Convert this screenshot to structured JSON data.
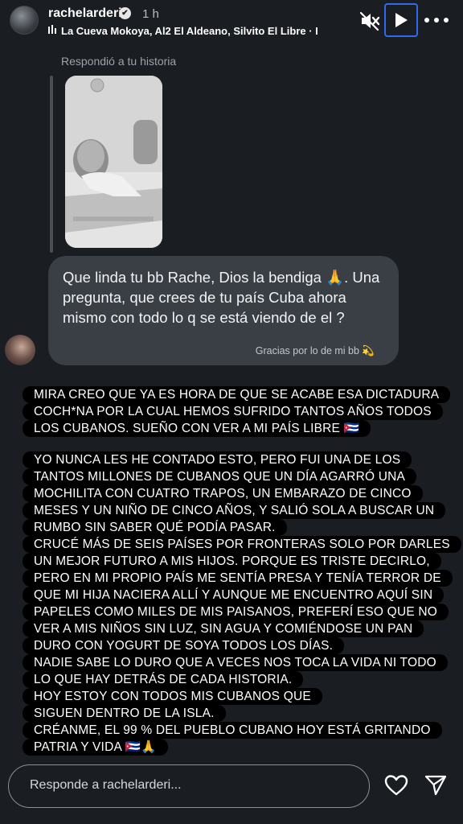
{
  "header": {
    "username": "rachelarderi",
    "verified_badge": "✔",
    "time": "1 h",
    "music_icon": "music-bars-icon",
    "music": "La Cueva Mokoya, Al2 El Aldeano, Silvito El Libre · I",
    "controls": [
      "mute-icon",
      "play-icon",
      "more-icon"
    ]
  },
  "story_reply": {
    "label": "Respondió a tu historia"
  },
  "received_message": {
    "text": "Que linda tu bb Rache, Dios la bendiga 🙏. Una pregunta, que crees de tu país Cuba ahora mismo con todo lo q se está viendo de el ?",
    "caption": "Gracias por lo de mi bb 💫"
  },
  "reply": {
    "paragraph1": [
      "MIRA CREO QUE YA ES HORA DE QUE SE ACABE ESA DICTADURA",
      "COCH*NA POR LA CUAL HEMOS SUFRIDO TANTOS AÑOS TODOS",
      "LOS CUBANOS. SUEÑO CON VER A MI PAÍS LIBRE 🇨🇺"
    ],
    "paragraph2": [
      "YO NUNCA LES HE CONTADO ESTO, PERO FUI UNA DE LOS",
      "TANTOS MILLONES DE CUBANOS QUE UN DÍA AGARRÓ UNA",
      "MOCHILITA CON CUATRO TRAPOS, UN EMBARAZO DE CINCO",
      "MESES Y UN NIÑO DE CINCO AÑOS, Y SALIÓ SOLA A BUSCAR UN",
      "RUMBO SIN SABER QUÉ PODÍA PASAR.",
      "CRUCÉ MÁS DE SEIS PAÍSES POR FRONTERAS SOLO POR DARLES",
      "UN MEJOR FUTURO A MIS HIJOS. PORQUE ES TRISTE DECIRLO,",
      "PERO EN MI PROPIO PAÍS ME SENTÍA PRESA Y TENÍA TERROR DE",
      "QUE MI HIJA NACIERA ALLÍ Y AUNQUE ME ENCUENTRO AQUÍ SIN",
      "PAPELES COMO MILES DE MIS PAISANOS, PREFERÍ ESO QUE NO",
      "VER A MIS NIÑOS SIN LUZ, SIN AGUA Y COMIÉNDOSE UN PAN",
      "DURO CON YOGURT DE SOYA TODOS LOS DÍAS.",
      "NADIE SABE LO DURO QUE A VECES NOS TOCA LA VIDA NI TODO",
      "LO QUE HAY DETRÁS DE CADA HISTORIA.",
      "HOY ESTOY CON TODOS MIS CUBANOS QUE",
      "SIGUEN DENTRO DE LA ISLA.",
      "CRÉANME, EL 99 % DEL PUEBLO CUBANO HOY ESTÁ GRITANDO",
      "PATRIA Y VIDA 🇨🇺🙏"
    ]
  },
  "footer": {
    "input_placeholder": "Responde a rachelarderi...",
    "icons": [
      "heart-icon",
      "send-icon"
    ]
  }
}
